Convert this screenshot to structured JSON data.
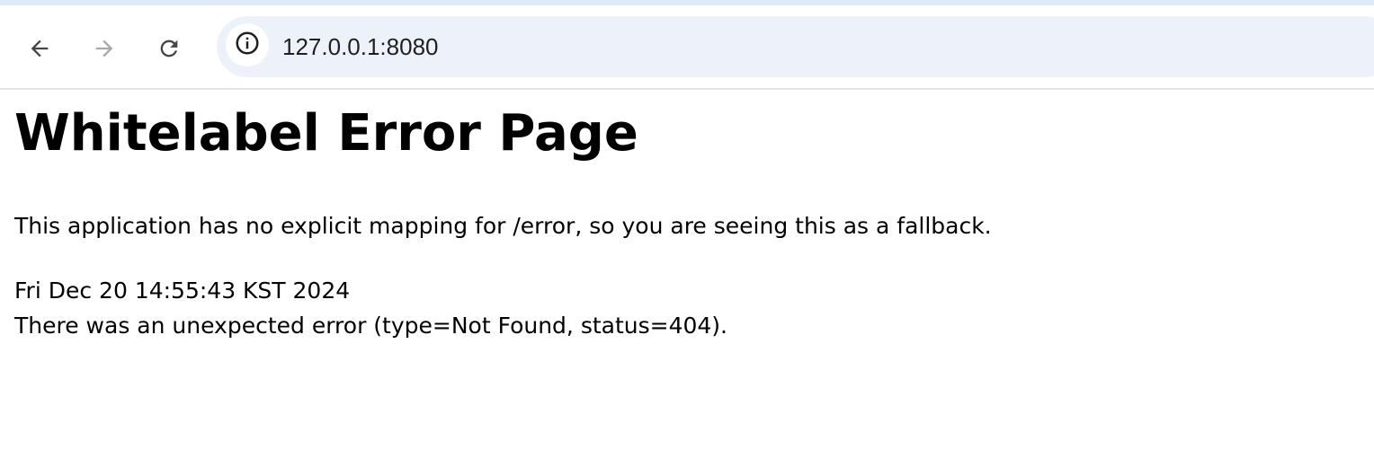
{
  "browser": {
    "url": "127.0.0.1:8080",
    "icons": {
      "back": "back-arrow-icon",
      "forward": "forward-arrow-icon",
      "reload": "reload-icon",
      "site_info": "info-icon"
    },
    "colors": {
      "omnibox_bg": "#edf2fa",
      "top_strip": "#dfe8f6",
      "icon_active": "#444746",
      "icon_disabled": "#a8a8a8"
    }
  },
  "page": {
    "title": "Whitelabel Error Page",
    "message": "This application has no explicit mapping for /error, so you are seeing this as a fallback.",
    "timestamp": "Fri Dec 20 14:55:43 KST 2024",
    "error_detail": "There was an unexpected error (type=Not Found, status=404)."
  }
}
